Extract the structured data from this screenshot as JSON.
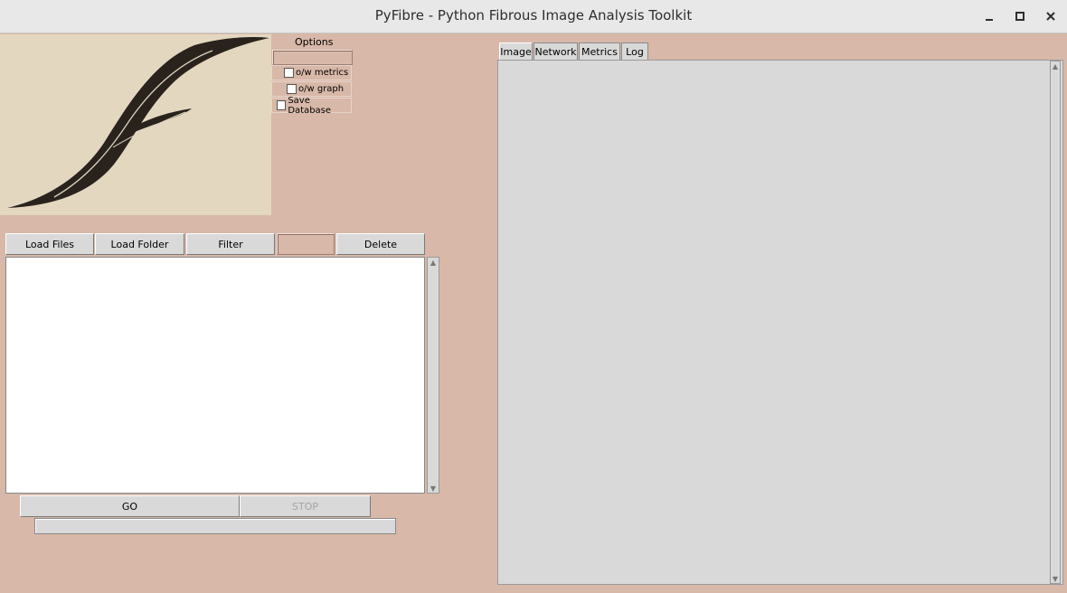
{
  "window": {
    "title": "PyFibre - Python Fibrous Image Analysis Toolkit",
    "controls": [
      "minimize-icon",
      "maximize-icon",
      "close-icon"
    ]
  },
  "logo": {
    "icon": "pyfibre-logo-fibre-image"
  },
  "options": {
    "label": "Options",
    "entry_value": "",
    "checkboxes": [
      {
        "label": "o/w metrics",
        "checked": false
      },
      {
        "label": "o/w graph",
        "checked": false
      },
      {
        "label": "Save Database",
        "checked": false
      }
    ]
  },
  "file_toolbar": {
    "load_files": "Load Files",
    "load_folder": "Load Folder",
    "filter": "Filter",
    "filter_value": "",
    "delete": "Delete"
  },
  "file_list": {
    "items": []
  },
  "run": {
    "go": "GO",
    "stop": "STOP",
    "progress": 0
  },
  "notebook": {
    "tabs": [
      {
        "label": "Image",
        "active": true
      },
      {
        "label": "Network",
        "active": false
      },
      {
        "label": "Metrics",
        "active": false
      },
      {
        "label": "Log",
        "active": false
      }
    ]
  },
  "colors": {
    "background": "#d8b8a8",
    "widget": "#d9d9d9",
    "titlebar": "#e8e8e8"
  }
}
